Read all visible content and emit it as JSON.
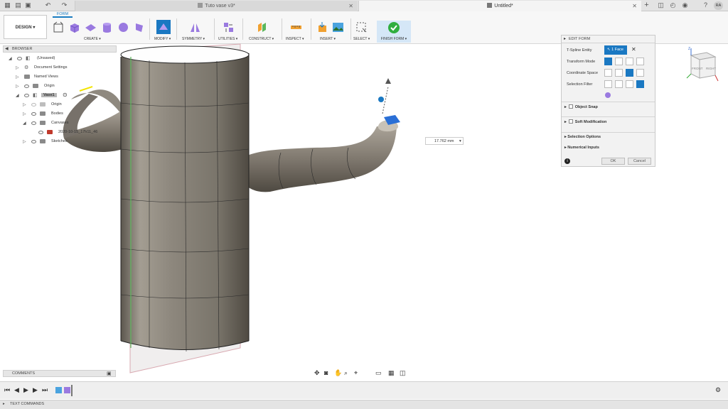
{
  "tabs": {
    "doc1": "Tuto vase v3*",
    "doc2": "Untitled*"
  },
  "toolbar": {
    "workspace": "DESIGN",
    "workspace_tab": "FORM",
    "groups": [
      "CREATE",
      "MODIFY",
      "SYMMETRY",
      "UTILITIES",
      "CONSTRUCT",
      "INSPECT",
      "INSERT",
      "SELECT",
      "FINISH FORM"
    ]
  },
  "user_initials": "RA",
  "browser": {
    "title": "BROWSER",
    "items": [
      "(Unsaved)",
      "Document Settings",
      "Named Views",
      "Origin",
      "Vase1",
      "Origin",
      "Bodies",
      "Canvases",
      "2020-10-15_17h11_46",
      "Sketches"
    ]
  },
  "edit_form": {
    "title": "EDIT FORM",
    "tspline_label": "T-Spline Entity",
    "tspline_value": "1 Face",
    "transform_label": "Transform Mode",
    "coord_label": "Coordinate Space",
    "filter_label": "Selection Filter",
    "object_snap": "Object Snap",
    "soft_mod": "Soft Modification",
    "selection_options": "Selection Options",
    "numerical_inputs": "Numerical Inputs",
    "ok": "OK",
    "cancel": "Cancel"
  },
  "dimension_value": "17.762 mm",
  "viewcube": {
    "front": "FRONT",
    "right": "RIGHT",
    "z": "Z"
  },
  "comments": "COMMENTS",
  "text_commands": "TEXT COMMANDS",
  "colors": {
    "accent": "#1a7cc1",
    "finish_green": "#2fae3f",
    "selected_face": "#2a6fd6"
  }
}
